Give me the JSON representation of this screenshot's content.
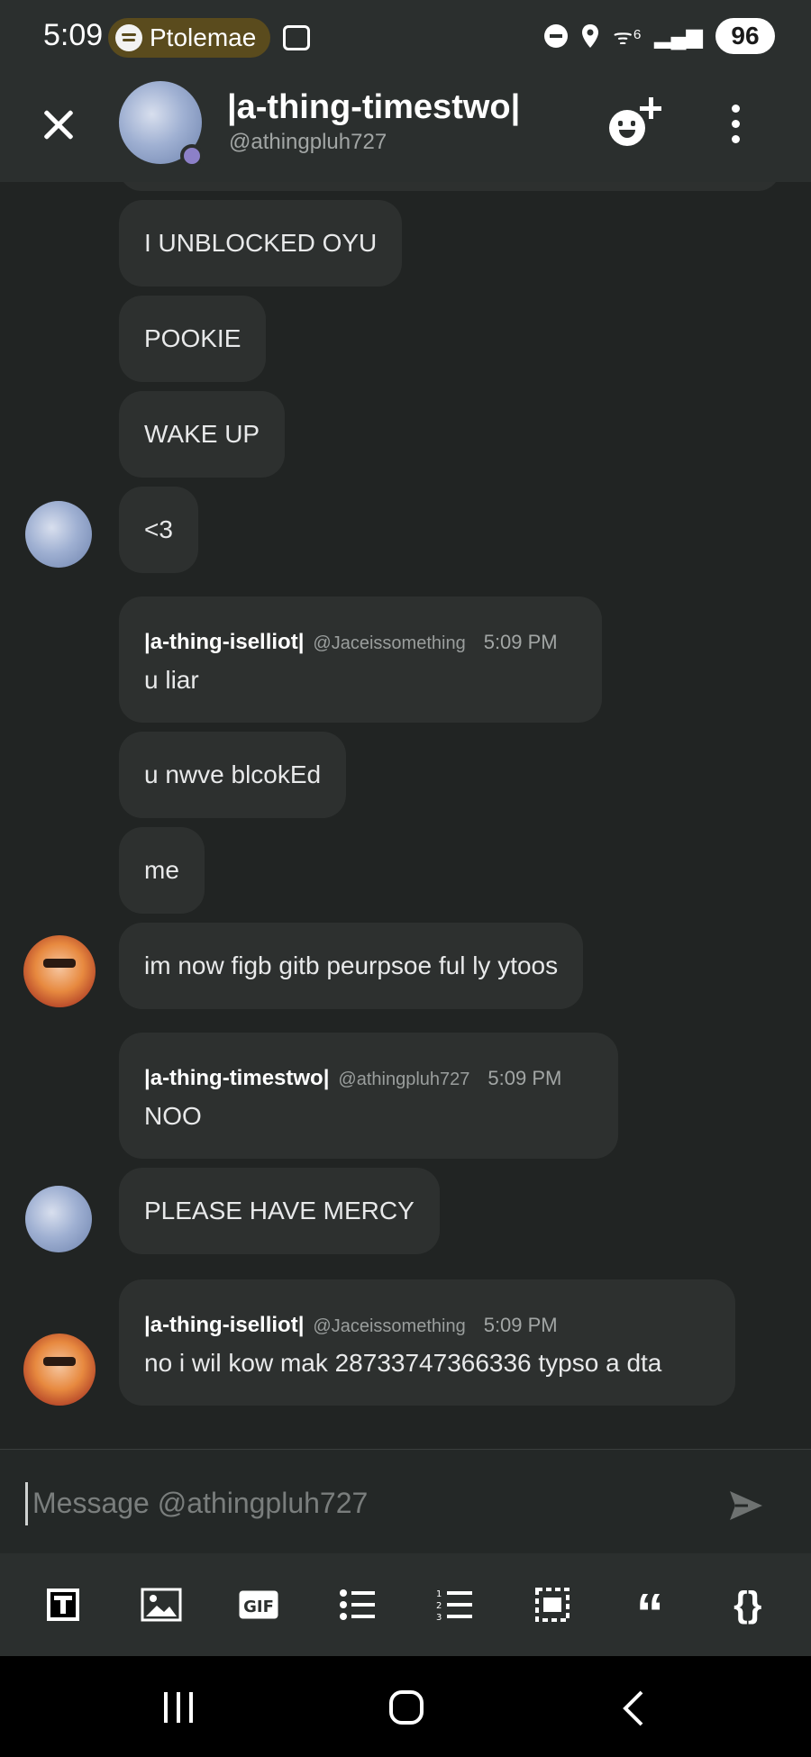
{
  "status_bar": {
    "time": "5:09",
    "media_label": "Ptolemae",
    "battery": "96",
    "wifi_glyph": "ᯤ⁶",
    "signal_glyph": "▂▄▆"
  },
  "header": {
    "name": "|a-thing-timestwo|",
    "handle": "@athingpluh727"
  },
  "messages": [
    {
      "type": "plain",
      "text": "I UNBLOCKED OYU"
    },
    {
      "type": "plain",
      "text": "POOKIE"
    },
    {
      "type": "plain",
      "text": "WAKE UP"
    },
    {
      "type": "plain",
      "text": "<3"
    },
    {
      "type": "header",
      "author": "|a-thing-iselliot|",
      "handle": "@Jaceissomething",
      "time": "5:09 PM",
      "text": "u liar"
    },
    {
      "type": "plain",
      "text": "u nwve blcokEd"
    },
    {
      "type": "plain",
      "text": "me"
    },
    {
      "type": "plain",
      "text": "im now figb gitb peurpsoe ful ly ytoos"
    },
    {
      "type": "header",
      "author": "|a-thing-timestwo|",
      "handle": "@athingpluh727",
      "time": "5:09 PM",
      "text": "NOO"
    },
    {
      "type": "plain",
      "text": "PLEASE HAVE MERCY"
    },
    {
      "type": "header",
      "author": "|a-thing-iselliot|",
      "handle": "@Jaceissomething",
      "time": "5:09 PM",
      "text": "no i wil kow mak 28733747366336 typso a dta"
    }
  ],
  "composer": {
    "placeholder": "Message @athingpluh727"
  },
  "toolbar": {
    "gif_label": "GIF",
    "quote_glyph": "“",
    "code_glyph": "{}"
  },
  "colors": {
    "background": "#212423",
    "bubble": "#2d302f",
    "header": "#2b2f2e",
    "status_dot": "#8c80c8",
    "media_pill": "#5a4b1d"
  }
}
